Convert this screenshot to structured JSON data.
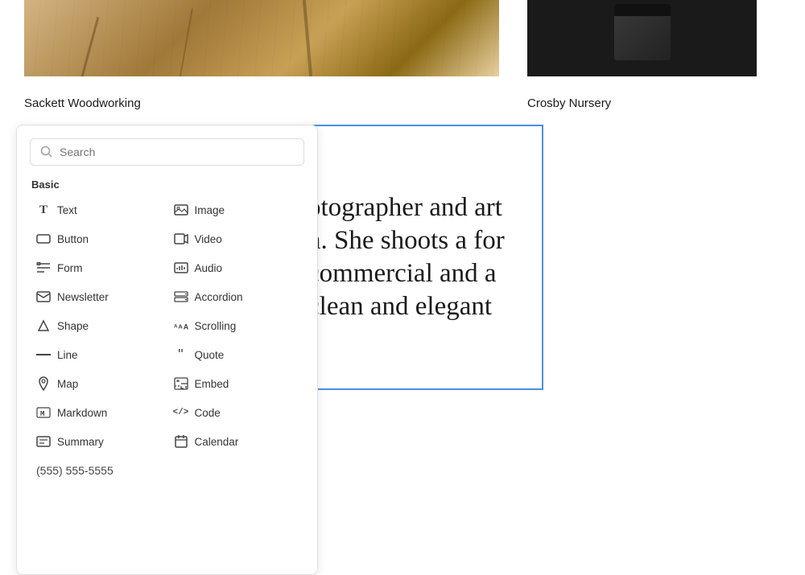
{
  "top": {
    "caption_left": "Sackett Woodworking",
    "caption_right": "Crosby Nursery"
  },
  "sidebar": {
    "search_placeholder": "Search",
    "section_basic": "Basic",
    "items_left": [
      {
        "id": "text",
        "label": "Text",
        "icon": "icon-text"
      },
      {
        "id": "button",
        "label": "Button",
        "icon": "icon-button"
      },
      {
        "id": "form",
        "label": "Form",
        "icon": "icon-form"
      },
      {
        "id": "newsletter",
        "label": "Newsletter",
        "icon": "icon-newsletter"
      },
      {
        "id": "shape",
        "label": "Shape",
        "icon": "icon-shape"
      },
      {
        "id": "line",
        "label": "Line",
        "icon": "icon-line"
      },
      {
        "id": "map",
        "label": "Map",
        "icon": "icon-map"
      },
      {
        "id": "markdown",
        "label": "Markdown",
        "icon": "icon-markdown"
      },
      {
        "id": "summary",
        "label": "Summary",
        "icon": "icon-summary"
      }
    ],
    "items_right": [
      {
        "id": "image",
        "label": "Image",
        "icon": "icon-image"
      },
      {
        "id": "video",
        "label": "Video",
        "icon": "icon-video"
      },
      {
        "id": "audio",
        "label": "Audio",
        "icon": "icon-audio"
      },
      {
        "id": "accordion",
        "label": "Accordion",
        "icon": "icon-accordion"
      },
      {
        "id": "scrolling",
        "label": "Scrolling",
        "icon": "icon-scrolling"
      },
      {
        "id": "quote",
        "label": "Quote",
        "icon": "icon-quote"
      },
      {
        "id": "embed",
        "label": "Embed",
        "icon": "icon-embed"
      },
      {
        "id": "code",
        "label": "Code",
        "icon": "icon-code"
      },
      {
        "id": "calendar",
        "label": "Calendar",
        "icon": "icon-calendar"
      }
    ]
  },
  "content": {
    "text": "otographer and art n. She shoots a for commercial and a clean and elegant",
    "phone": "(555) 555-5555"
  }
}
